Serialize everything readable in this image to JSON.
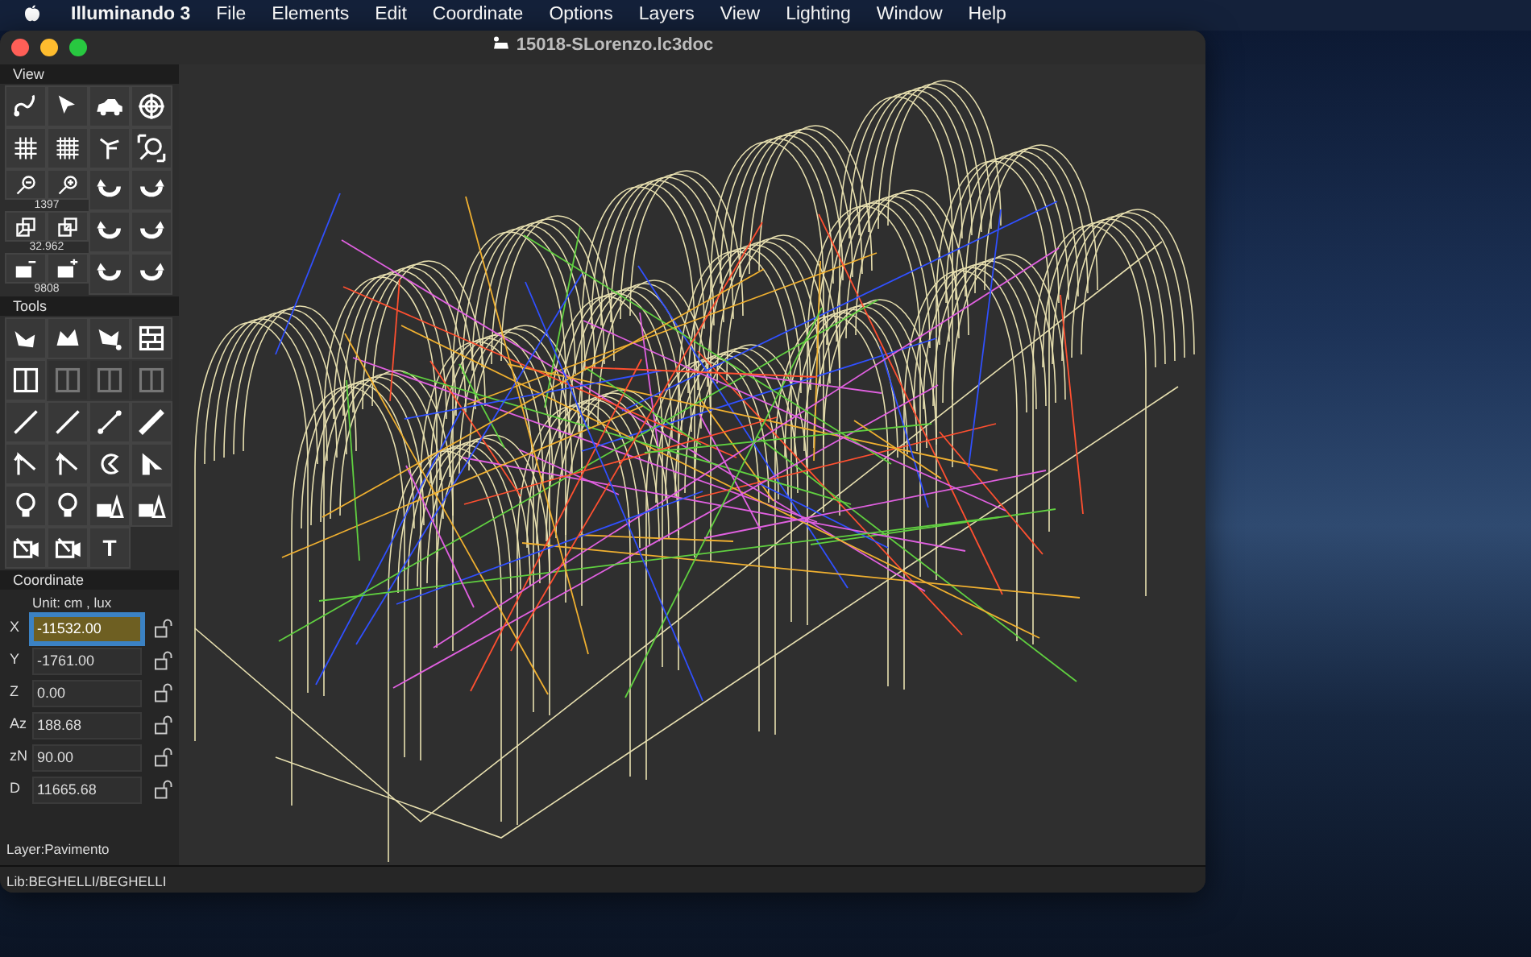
{
  "menu_bar": {
    "app_name": "Illuminando 3",
    "menus": [
      "File",
      "Elements",
      "Edit",
      "Coordinate",
      "Options",
      "Layers",
      "View",
      "Lighting",
      "Window",
      "Help"
    ]
  },
  "window": {
    "title": "15018-SLorenzo.lc3doc"
  },
  "sidebar": {
    "view": {
      "title": "View",
      "readouts": [
        "1397",
        "32.962",
        "9808"
      ]
    },
    "tools": {
      "title": "Tools",
      "buttons": [
        {
          "disabled": false
        },
        {
          "disabled": false
        },
        {
          "disabled": false
        },
        {
          "disabled": false
        },
        {
          "disabled": false
        },
        {
          "disabled": true
        },
        {
          "disabled": true
        },
        {
          "disabled": true
        },
        {
          "disabled": false
        },
        {
          "disabled": false
        },
        {
          "disabled": false
        },
        {
          "disabled": false
        },
        {
          "disabled": false
        },
        {
          "disabled": false
        },
        {
          "disabled": false
        },
        {
          "disabled": false
        },
        {
          "disabled": false
        },
        {
          "disabled": false
        },
        {
          "disabled": false
        },
        {
          "disabled": false
        },
        {
          "disabled": false
        },
        {
          "disabled": false
        },
        {
          "label": "T",
          "disabled": false
        }
      ]
    },
    "coordinate": {
      "title": "Coordinate",
      "unit": "Unit:  cm ,  lux",
      "fields": [
        {
          "label": "X",
          "value": "-11532.00",
          "selected": true,
          "locked": false
        },
        {
          "label": "Y",
          "value": "-1761.00",
          "selected": false,
          "locked": false
        },
        {
          "label": "Z",
          "value": "0.00",
          "selected": false,
          "locked": false
        },
        {
          "label": "Az",
          "value": "188.68",
          "selected": false,
          "locked": false
        },
        {
          "label": "zN",
          "value": "90.00",
          "selected": false,
          "locked": false
        },
        {
          "label": "D",
          "value": "11665.68",
          "selected": false,
          "locked": false
        }
      ]
    },
    "layer": "Layer:Pavimento"
  },
  "status_bar": "Lib:BEGHELLI/BEGHELLI"
}
